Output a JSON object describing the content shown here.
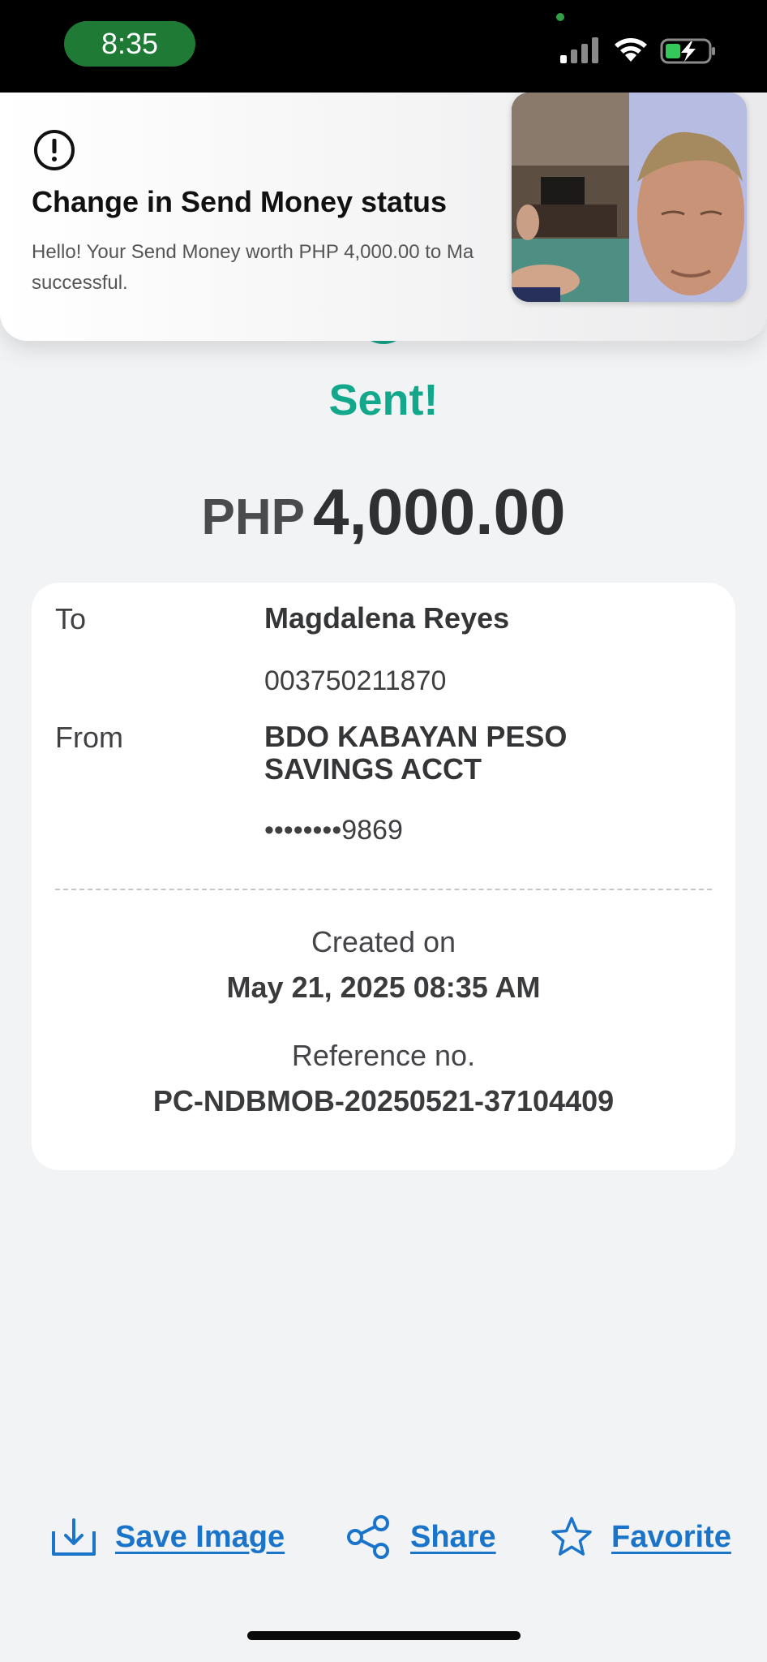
{
  "status_bar": {
    "time": "8:35"
  },
  "notification": {
    "title": "Change in Send Money status",
    "body_line1": "Hello! Your Send Money worth PHP 4,000.00 to Ma",
    "body_line2": "successful."
  },
  "transaction": {
    "status": "Sent!",
    "currency": "PHP",
    "amount": "4,000.00",
    "to_label": "To",
    "to_name": "Magdalena Reyes",
    "to_account": "003750211870",
    "from_label": "From",
    "from_name_line1": "BDO KABAYAN PESO",
    "from_name_line2": "SAVINGS ACCT",
    "from_account": "••••••••9869",
    "created_label": "Created on",
    "created_value": "May 21, 2025 08:35 AM",
    "reference_label": "Reference no.",
    "reference_value": "PC-NDBMOB-20250521-37104409"
  },
  "actions": {
    "save_image": "Save Image",
    "share": "Share",
    "favorite": "Favorite"
  },
  "colors": {
    "accent_green": "#13a88c",
    "link_blue": "#1a74c9",
    "time_pill": "#1f7a35"
  }
}
